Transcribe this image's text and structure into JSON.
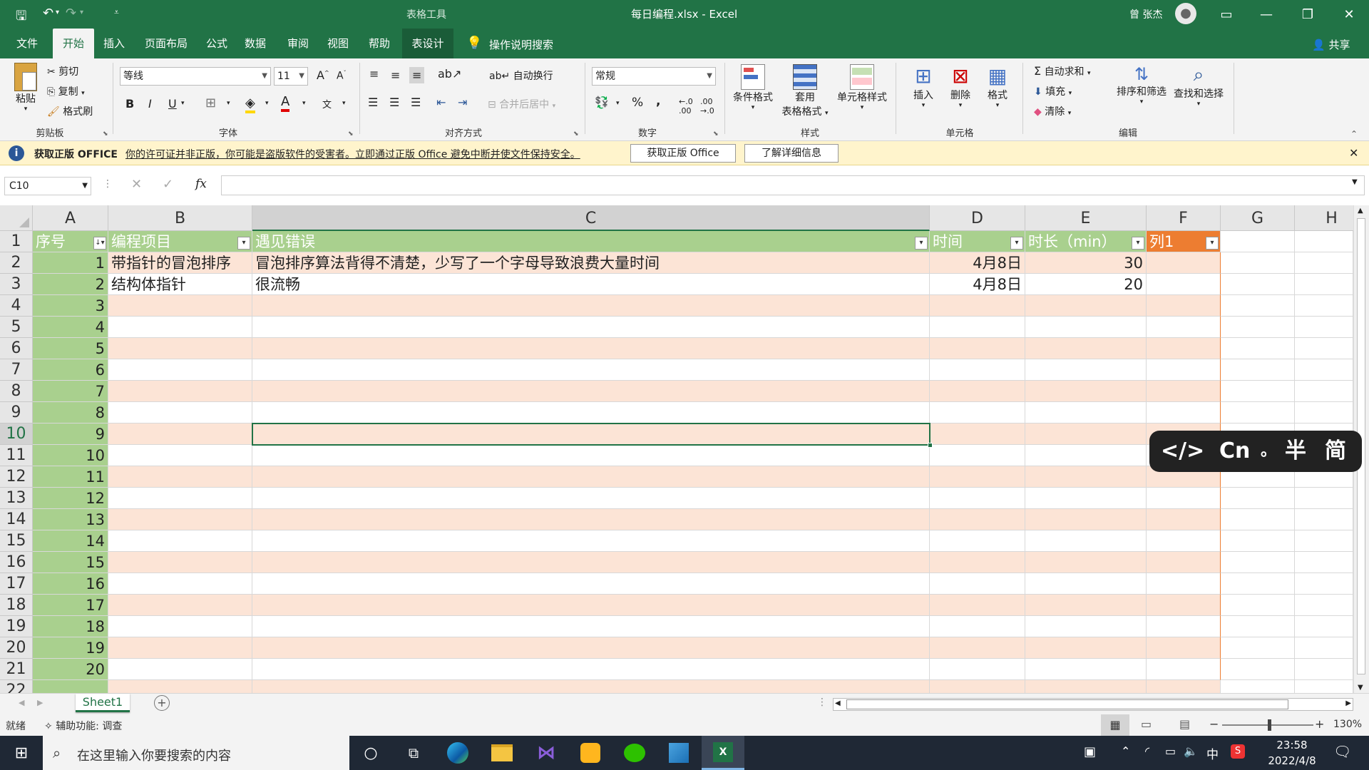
{
  "window": {
    "title": "每日编程.xlsx - Excel",
    "context_tools": "表格工具",
    "user": "曾 张杰"
  },
  "tabs": [
    "文件",
    "开始",
    "插入",
    "页面布局",
    "公式",
    "数据",
    "审阅",
    "视图",
    "帮助",
    "表设计"
  ],
  "tell_me": "操作说明搜索",
  "share": "共享",
  "ribbon": {
    "clipboard": {
      "paste": "粘贴",
      "cut": "剪切",
      "copy": "复制",
      "format_painter": "格式刷",
      "label": "剪贴板"
    },
    "font": {
      "name": "等线",
      "size": "11",
      "label": "字体",
      "bold": "B",
      "italic": "I",
      "underline": "U",
      "grow": "A",
      "shrink": "A",
      "phonetic": "文"
    },
    "alignment": {
      "wrap": "自动换行",
      "merge": "合并后居中",
      "label": "对齐方式"
    },
    "number": {
      "format": "常规",
      "label": "数字",
      "percent": "%",
      "comma": ","
    },
    "styles": {
      "conditional": "条件格式",
      "table": "套用",
      "table2": "表格格式",
      "cell": "单元格样式",
      "label": "样式"
    },
    "cells": {
      "insert": "插入",
      "delete": "删除",
      "format": "格式",
      "label": "单元格"
    },
    "editing": {
      "autosum": "自动求和",
      "fill": "填充",
      "clear": "清除",
      "sort": "排序和筛选",
      "find": "查找和选择",
      "label": "编辑"
    }
  },
  "message_bar": {
    "title": "获取正版 OFFICE",
    "text": "你的许可证并非正版，你可能是盗版软件的受害者。立即通过正版 Office 避免中断并使文件保持安全。",
    "btn1": "获取正版 Office",
    "btn2": "了解详细信息"
  },
  "formula": {
    "name_box": "C10",
    "fx": "fx",
    "value": ""
  },
  "columns": [
    "A",
    "B",
    "C",
    "D",
    "E",
    "F",
    "G",
    "H"
  ],
  "table_headers": [
    "序号",
    "编程项目",
    "遇见错误",
    "时间",
    "时长（min）",
    "列1"
  ],
  "rows": [
    {
      "n": "1",
      "item": "带指针的冒泡排序",
      "error": "冒泡排序算法背得不清楚，少写了一个字母导致浪费大量时间",
      "date": "4月8日",
      "dur": "30"
    },
    {
      "n": "2",
      "item": "结构体指针",
      "error": "很流畅",
      "date": "4月8日",
      "dur": "20"
    },
    {
      "n": "3"
    },
    {
      "n": "4"
    },
    {
      "n": "5"
    },
    {
      "n": "6"
    },
    {
      "n": "7"
    },
    {
      "n": "8"
    },
    {
      "n": "9"
    },
    {
      "n": "10"
    },
    {
      "n": "11"
    },
    {
      "n": "12"
    },
    {
      "n": "13"
    },
    {
      "n": "14"
    },
    {
      "n": "15"
    },
    {
      "n": "16"
    },
    {
      "n": "17"
    },
    {
      "n": "18"
    },
    {
      "n": "19"
    },
    {
      "n": "20"
    }
  ],
  "row_numbers": [
    "1",
    "2",
    "3",
    "4",
    "5",
    "6",
    "7",
    "8",
    "9",
    "10",
    "11",
    "12",
    "13",
    "14",
    "15",
    "16",
    "17",
    "18",
    "19",
    "20",
    "21",
    "22"
  ],
  "ime": {
    "code": "</>",
    "cn": "Cn",
    "dot": "。",
    "half": "半",
    "simp": "简"
  },
  "sheet": {
    "name": "Sheet1"
  },
  "status": {
    "ready": "就绪",
    "accessibility": "辅助功能: 调查",
    "zoom": "130%"
  },
  "taskbar": {
    "search": "在这里输入你要搜索的内容",
    "time": "23:58",
    "date": "2022/4/8",
    "lang": "中"
  },
  "colors": {
    "excel_green": "#217346",
    "header_green": "#a9d08e",
    "band_peach": "#fce4d6",
    "col_orange": "#ed7d31",
    "index_green": "#a9d08e"
  }
}
